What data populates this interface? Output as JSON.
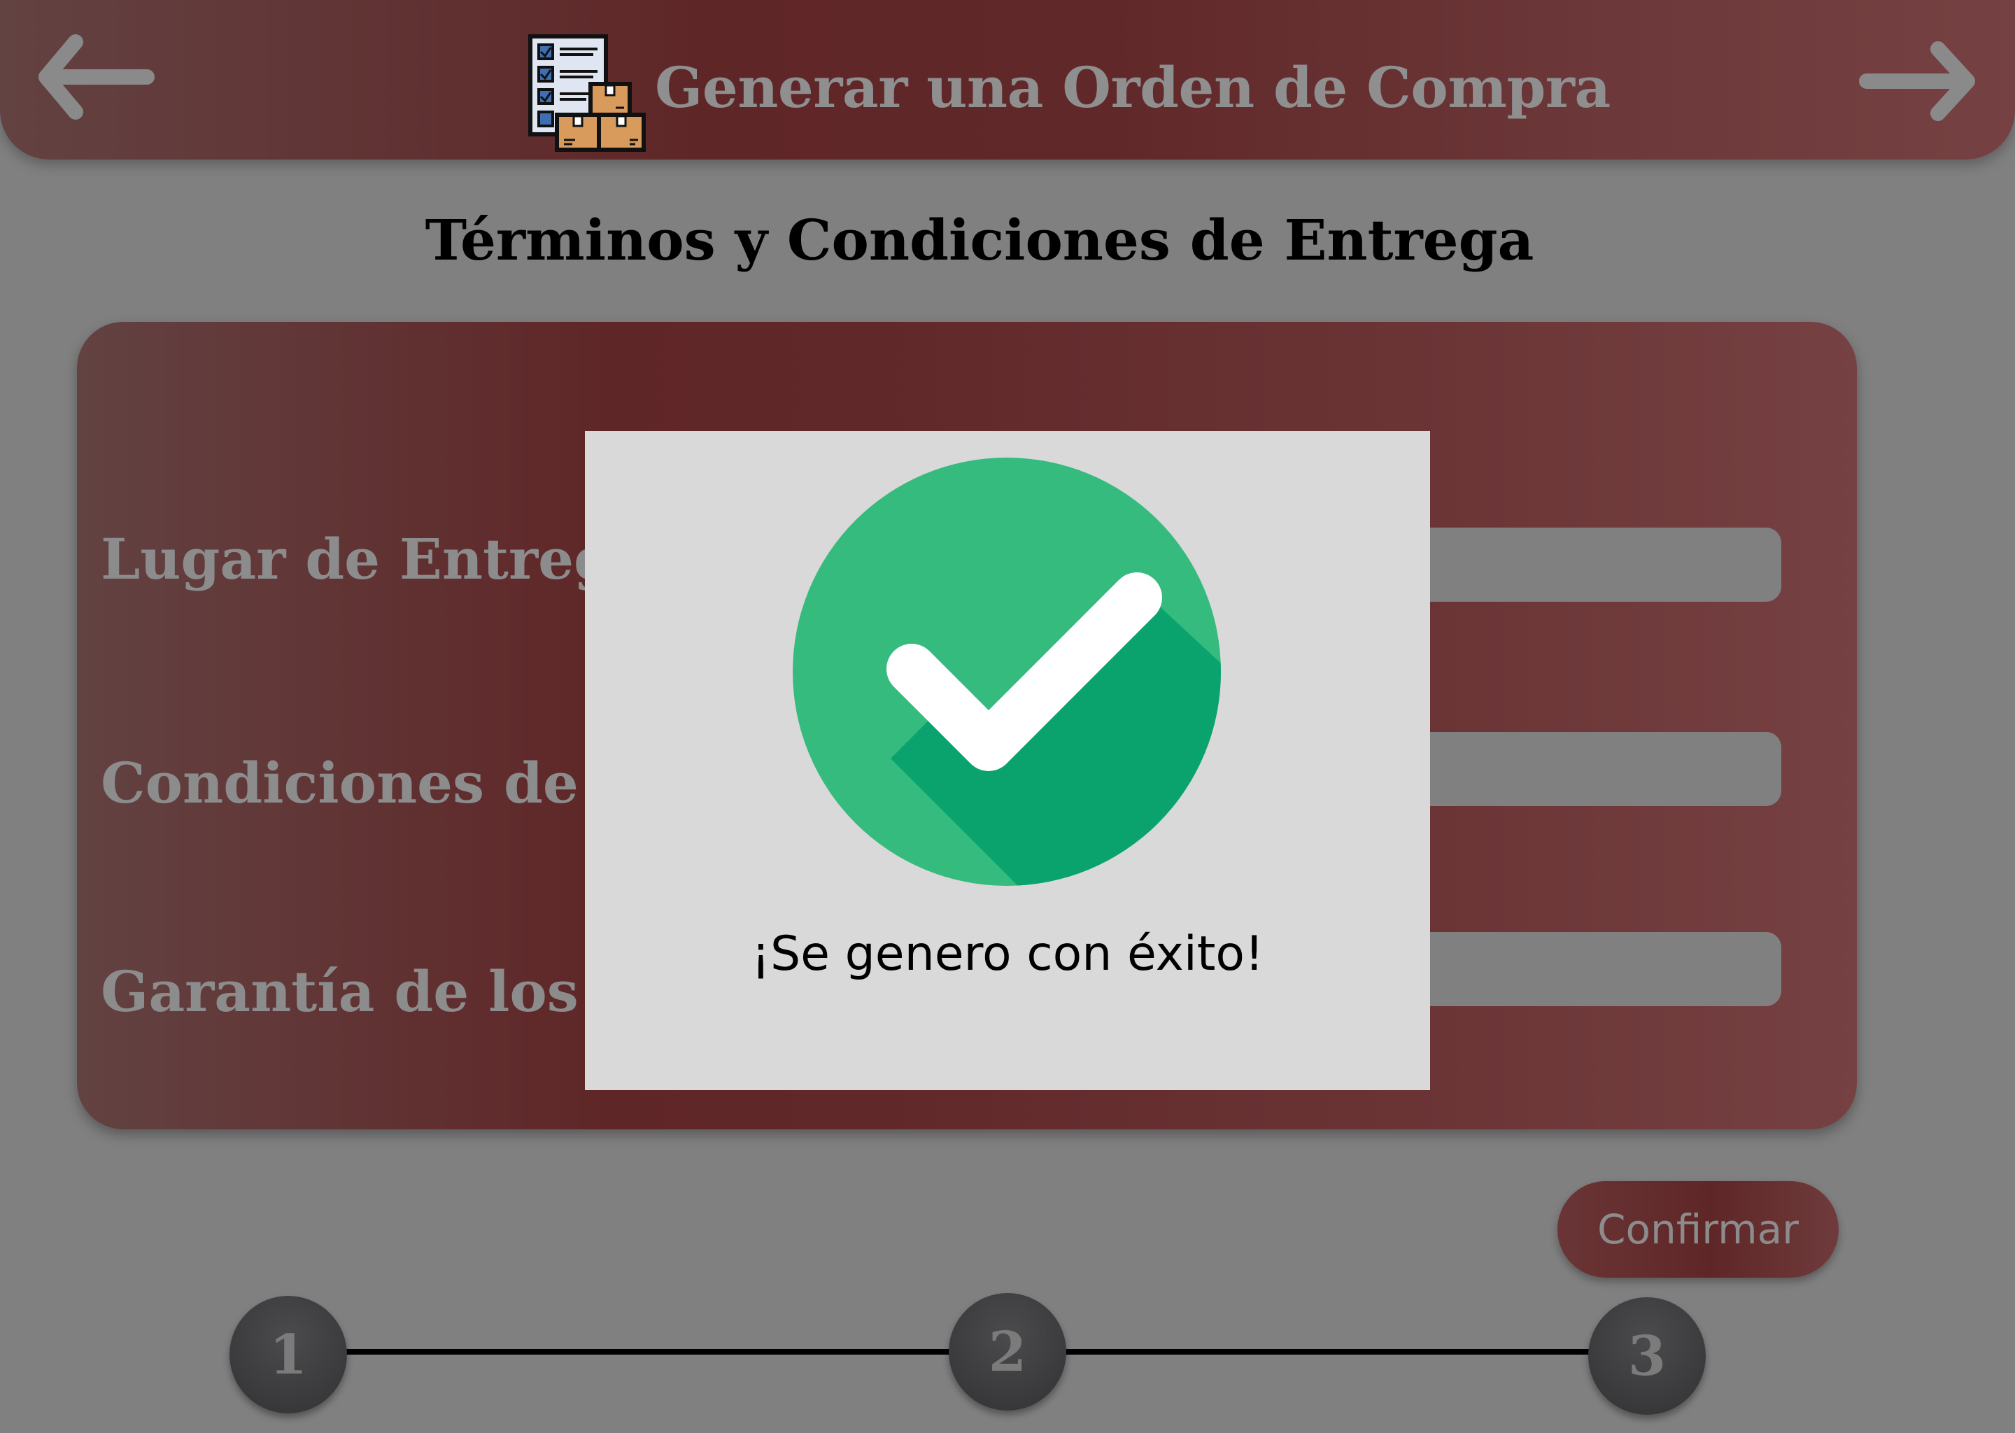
{
  "header": {
    "title": "Generar una Orden de Compra",
    "back_icon": "arrow-left-icon",
    "forward_icon": "arrow-right-icon",
    "app_icon": "purchase-order-checklist-boxes-icon"
  },
  "page_title": "Términos y Condiciones de Entrega",
  "form": {
    "fields": [
      {
        "label": "Lugar de Entrega:",
        "value": ""
      },
      {
        "label": "Condiciones de Entrega:",
        "value": ""
      },
      {
        "label": "Garantía de los Productos:",
        "value": ""
      }
    ]
  },
  "confirm_button": {
    "label": "Confirmar"
  },
  "stepper": {
    "steps": [
      "1",
      "2",
      "3"
    ],
    "current": 3
  },
  "modal": {
    "message": "¡Se genero con éxito!",
    "icon": "success-check-icon"
  },
  "colors": {
    "burgundy": "#5f2627",
    "overlay_gray": "#808080",
    "modal_bg": "#d9d9d9",
    "success_green": "#35bb7d",
    "success_green_shadow": "#0ba36d"
  }
}
